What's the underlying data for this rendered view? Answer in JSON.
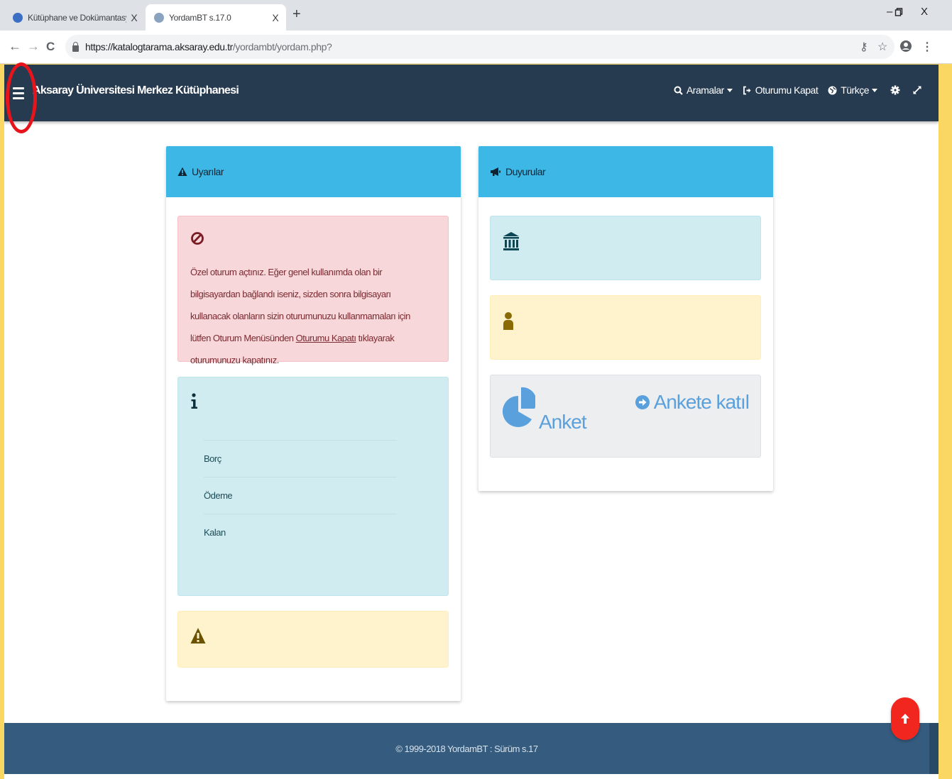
{
  "browser": {
    "tabs": [
      {
        "title": "Kütüphane ve Dokümantasyon D",
        "active": false,
        "close": "X"
      },
      {
        "title": "YordamBT s.17.0",
        "active": true,
        "close": "X"
      }
    ],
    "new_tab": "+",
    "window_controls": {
      "minimize": "–",
      "restore": "▯",
      "close": "X"
    },
    "nav": {
      "back": "←",
      "forward": "→",
      "reload": "C"
    },
    "url_host": "https://katalogtarama.aksaray.edu.tr",
    "url_path": "/yordambt/yordam.php?",
    "right_icons": {
      "key": "⚷",
      "star": "☆",
      "menu": "⋮"
    }
  },
  "colors": {
    "navbar": "#263a50",
    "card_header": "#3db8e6",
    "footer": "#355b7e",
    "accent_red": "#f0261f",
    "anket_blue": "#5aa0dd"
  },
  "navbar": {
    "site_title": "Aksaray Üniversitesi Merkez Kütüphanesi",
    "items": [
      {
        "label": "Aramalar",
        "icon": "search-icon",
        "dropdown": true
      },
      {
        "label": "Oturumu Kapat",
        "icon": "sign-out-icon",
        "dropdown": false
      },
      {
        "label": "Türkçe",
        "icon": "globe-icon",
        "dropdown": true
      }
    ]
  },
  "warnings_card": {
    "title": "Uyarılar",
    "danger_text": "Özel oturum açtınız. Eğer genel kullanımda olan bir bilgisayardan bağlandı iseniz, sizden sonra bilgisayarı kullanacak olanların sizin oturumunuzu kullanmamaları için lütfen Oturum Menüsünden",
    "danger_link": "Oturumu Kapatı",
    "danger_tail": " tıklayarak oturumunuzu kapatınız.",
    "debt_rows": [
      "Borç",
      "Ödeme",
      "Kalan"
    ]
  },
  "announcements_card": {
    "title": "Duyurular",
    "survey_label": "Anket",
    "survey_link": "Ankete katıl"
  },
  "footer": {
    "copyright": "© 1999-2018 YordamBT : Sürüm s.17"
  }
}
